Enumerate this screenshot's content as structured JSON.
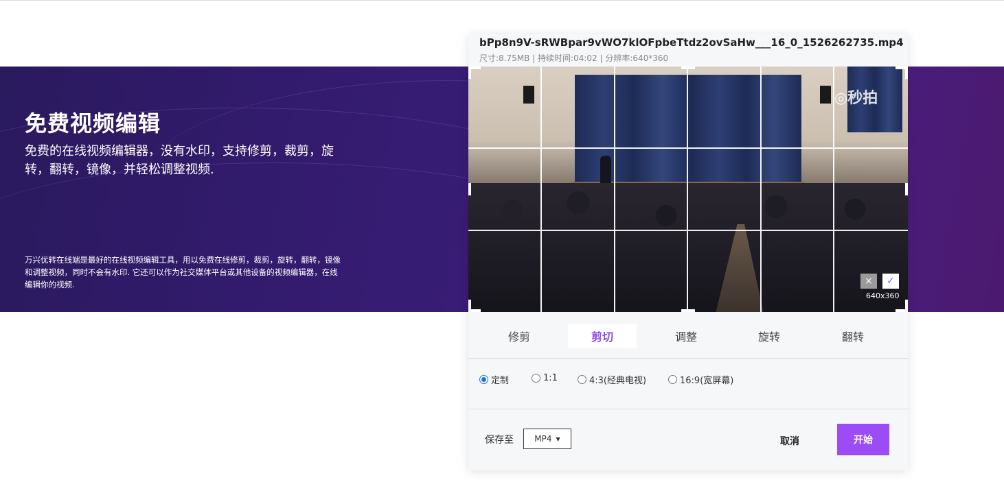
{
  "hero": {
    "title": "免费视频编辑",
    "subtitle": "免费的在线视频编辑器，没有水印，支持修剪，裁剪，旋转，翻转，镜像，并轻松调整视频.",
    "description": "万兴优转在线端是最好的在线视频编辑工具，用以免费在线修剪，裁剪，旋转，翻转，镜像和调整视频，同时不会有水印. 它还可以作为社交媒体平台或其他设备的视频编辑器，在线编辑你的视频."
  },
  "editor": {
    "file_name": "bPp8n9V-sRWBpar9vWO7klOFpbeTtdz2ovSaHw___16_0_1526262735.mp4",
    "file_meta": "尺寸:8.75MB | 持续时间:04:02 | 分辨率:640*360",
    "video": {
      "watermark": "◎秒拍",
      "crop_size": "640x360",
      "crop_cancel_icon": "×",
      "crop_confirm_icon": "✓"
    },
    "tabs": [
      {
        "label": "修剪",
        "active": false
      },
      {
        "label": "剪切",
        "active": true
      },
      {
        "label": "调整",
        "active": false
      },
      {
        "label": "旋转",
        "active": false
      },
      {
        "label": "翻转",
        "active": false
      }
    ],
    "ratio_options": [
      {
        "label": "定制",
        "checked": true
      },
      {
        "label": "1:1",
        "checked": false
      },
      {
        "label": "4:3(经典电视)",
        "checked": false
      },
      {
        "label": "16:9(宽屏幕)",
        "checked": false
      }
    ],
    "save_label": "保存至",
    "format": "MP4",
    "format_caret": "▼",
    "cancel_label": "取消",
    "start_label": "开始",
    "accent_color": "#9c4cf5"
  }
}
